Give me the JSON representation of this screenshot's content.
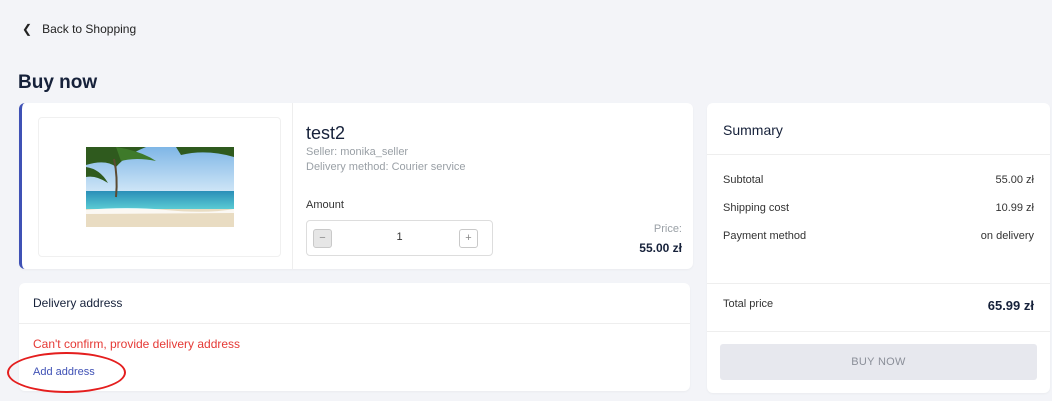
{
  "nav": {
    "back_label": "Back to Shopping"
  },
  "page": {
    "title": "Buy now"
  },
  "product": {
    "name": "test2",
    "seller": "Seller: monika_seller",
    "delivery_method": "Delivery method: Courier service",
    "amount_label": "Amount",
    "quantity": "1",
    "minus_label": "−",
    "plus_label": "+",
    "price_label": "Price:",
    "price": "55.00 zł"
  },
  "delivery": {
    "title": "Delivery address",
    "warning": "Can't confirm, provide delivery address",
    "add_address_label": "Add address"
  },
  "summary": {
    "title": "Summary",
    "rows": [
      {
        "label": "Subtotal",
        "value": "55.00 zł"
      },
      {
        "label": "Shipping cost",
        "value": "10.99 zł"
      },
      {
        "label": "Payment method",
        "value": "on delivery"
      }
    ],
    "total_label": "Total price",
    "total_value": "65.99 zł",
    "buy_label": "BUY NOW"
  },
  "colors": {
    "accent": "#3f51b5",
    "error": "#e53935",
    "annotation_circle": "#e41e1e"
  },
  "icons": {
    "back": "chevron-left-icon"
  }
}
